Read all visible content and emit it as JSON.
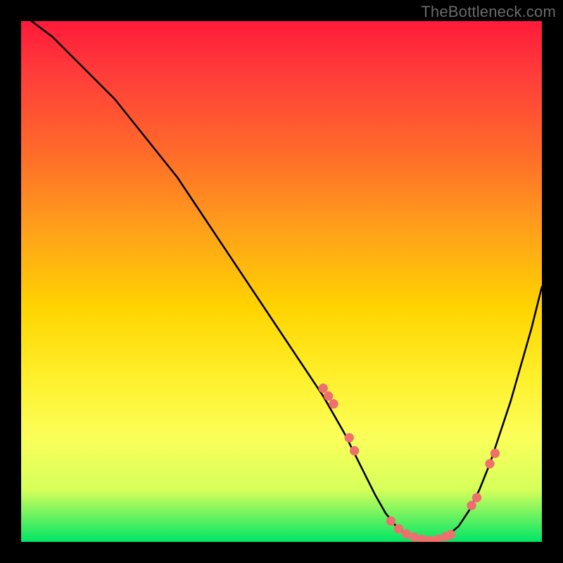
{
  "watermark": "TheBottleneck.com",
  "chart_data": {
    "type": "line",
    "title": "",
    "xlabel": "",
    "ylabel": "",
    "xlim": [
      0,
      100
    ],
    "ylim": [
      0,
      100
    ],
    "grid": false,
    "legend": false,
    "background": "rainbow-vertical-gradient (red→yellow→green)",
    "series": [
      {
        "name": "curve",
        "color": "#000000",
        "x": [
          2,
          6,
          10,
          14,
          18,
          22,
          26,
          30,
          34,
          38,
          42,
          46,
          50,
          54,
          58,
          62,
          64,
          66,
          68,
          70,
          72,
          74,
          76,
          78,
          80,
          82,
          84,
          86,
          88,
          90,
          92,
          94,
          96,
          98,
          100
        ],
        "y": [
          100,
          97,
          93,
          89,
          85,
          80,
          75,
          70,
          64,
          58,
          52,
          46,
          40,
          34,
          28,
          21,
          17,
          13,
          9,
          5.5,
          3,
          1.5,
          0.7,
          0.3,
          0.5,
          1.3,
          3,
          6,
          10,
          15,
          21,
          27,
          34,
          41,
          49
        ]
      },
      {
        "name": "markers",
        "color": "#ef6f6f",
        "type": "scatter",
        "x": [
          58,
          59,
          60,
          63,
          64,
          71,
          72.5,
          74,
          75.5,
          77,
          78.5,
          80,
          81.5,
          82.5,
          86.5,
          87.5,
          90,
          91
        ],
        "y": [
          29.5,
          28,
          26.5,
          20,
          17.5,
          4,
          2.5,
          1.5,
          0.9,
          0.5,
          0.3,
          0.5,
          1.0,
          1.4,
          7,
          8.5,
          15,
          17
        ]
      }
    ],
    "note": "No axis ticks or numeric labels are shown; values above are estimated from the curve shape and marker positions on a 0–100 normalized plot area."
  }
}
